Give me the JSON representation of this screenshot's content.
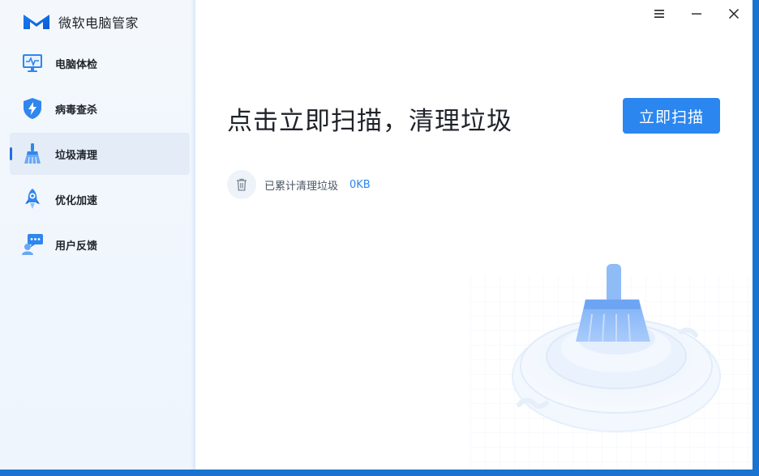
{
  "app": {
    "title": "微软电脑管家"
  },
  "sidebar": {
    "items": [
      {
        "label": "电脑体检",
        "icon": "monitor-icon",
        "active": false
      },
      {
        "label": "病毒查杀",
        "icon": "shield-icon",
        "active": false
      },
      {
        "label": "垃圾清理",
        "icon": "broom-icon",
        "active": true
      },
      {
        "label": "优化加速",
        "icon": "rocket-icon",
        "active": false
      },
      {
        "label": "用户反馈",
        "icon": "feedback-icon",
        "active": false
      }
    ]
  },
  "window_controls": {
    "menu": "☰",
    "minimize": "—",
    "close": "✕"
  },
  "main": {
    "headline": "点击立即扫描，清理垃圾",
    "scan_button": "立即扫描",
    "stat_label": "已累计清理垃圾",
    "stat_value": "0KB"
  },
  "colors": {
    "accent": "#2b86f0",
    "sidebar_bg": "#f1f6fc",
    "frame": "#1a73d1"
  }
}
